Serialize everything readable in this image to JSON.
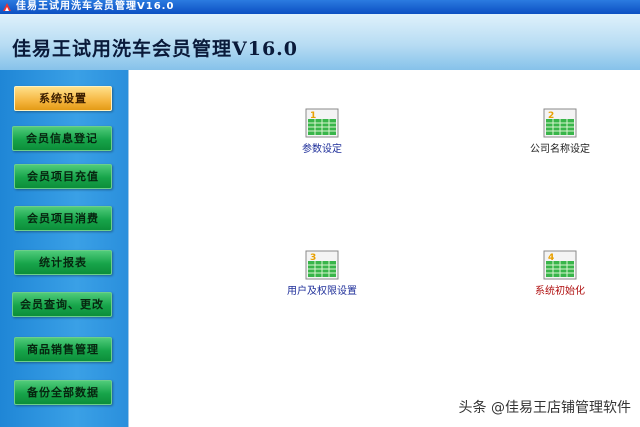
{
  "window": {
    "title": "佳易王试用洗车会员管理V16.0"
  },
  "header": {
    "app_title": "佳易王试用洗车会员管理V16.0"
  },
  "sidebar": {
    "items": [
      {
        "label": "系统设置",
        "active": true
      },
      {
        "label": "会员信息登记"
      },
      {
        "label": "会员项目充值"
      },
      {
        "label": "会员项目消费"
      },
      {
        "label": "统计报表"
      },
      {
        "label": "会员查询、更改"
      },
      {
        "label": "商品销售管理"
      },
      {
        "label": "备份全部数据"
      }
    ]
  },
  "main": {
    "tiles": [
      {
        "number": "1",
        "label": "参数设定"
      },
      {
        "number": "2",
        "label": "公司名称设定"
      },
      {
        "number": "3",
        "label": "用户及权限设置"
      },
      {
        "number": "4",
        "label": "系统初始化"
      }
    ]
  },
  "watermark": {
    "text": "头条 @佳易王店铺管理软件"
  },
  "colors": {
    "accent": "#f5b640",
    "nav": "#17a44a",
    "banner": "#b7dcf3"
  }
}
